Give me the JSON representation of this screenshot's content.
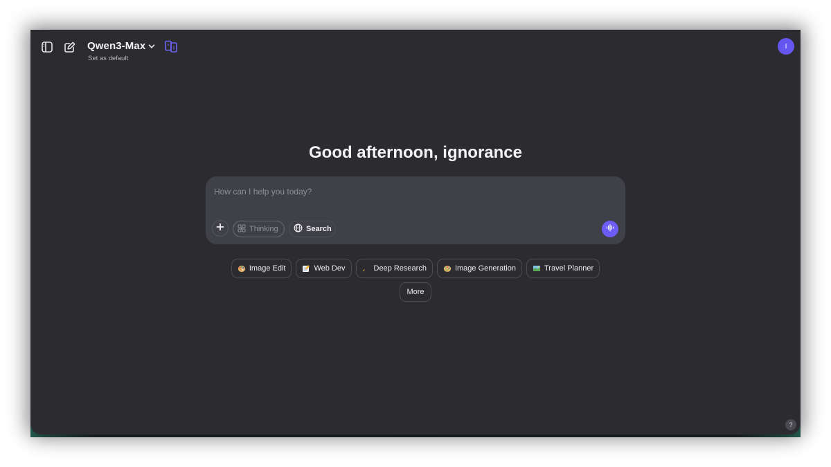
{
  "header": {
    "model_name": "Qwen3-Max",
    "set_default": "Set as default",
    "avatar_initial": "I",
    "icons": [
      "sidebar-toggle-icon",
      "new-chat-icon",
      "chevron-down-icon",
      "compare-models-icon"
    ]
  },
  "greeting": "Good afternoon, ignorance",
  "composer": {
    "placeholder": "How can I help you today?",
    "value": "",
    "thinking_label": "Thinking",
    "search_label": "Search",
    "icons": [
      "plus-icon",
      "thinking-icon",
      "globe-icon",
      "voice-wave-icon"
    ]
  },
  "quick_actions": [
    {
      "label": "Image Edit",
      "icon": "palette-emoji"
    },
    {
      "label": "Web Dev",
      "icon": "memo-emoji"
    },
    {
      "label": "Deep Research",
      "icon": "graduation-cap-emoji"
    },
    {
      "label": "Image Generation",
      "icon": "artist-palette-emoji"
    },
    {
      "label": "Travel Planner",
      "icon": "map-emoji"
    }
  ],
  "more_label": "More",
  "help_label": "?",
  "colors": {
    "background": "#2b2b30",
    "composer": "#404048",
    "accent": "#6656f0",
    "text": "#f2f2f4"
  }
}
